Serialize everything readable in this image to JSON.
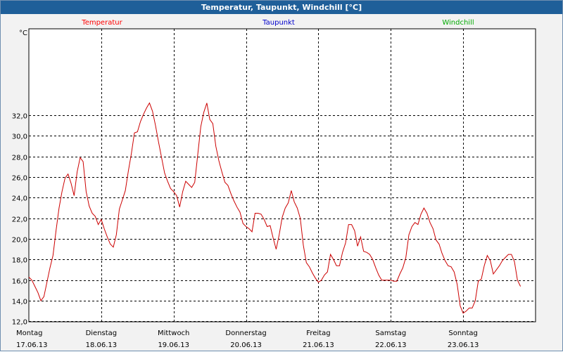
{
  "window": {
    "title": "Temperatur, Taupunkt, Windchill [°C]"
  },
  "chart_data": {
    "type": "line",
    "title": "Temperatur, Taupunkt, Windchill [°C]",
    "ylabel": "°C",
    "ylim": [
      11.96,
      40.4
    ],
    "yticks": [
      "12,0",
      "14,0",
      "16,0",
      "18,0",
      "20,0",
      "22,0",
      "24,0",
      "26,0",
      "28,0",
      "30,0",
      "32,0"
    ],
    "grid": true,
    "legend": [
      {
        "name": "Temperatur",
        "color": "#ff0000",
        "position": "top-left"
      },
      {
        "name": "Taupunkt",
        "color": "#0000cc",
        "position": "top-center"
      },
      {
        "name": "Windchill",
        "color": "#00aa00",
        "position": "top-right"
      }
    ],
    "x_day_labels": [
      {
        "day": "Montag",
        "date": "17.06.13"
      },
      {
        "day": "Dienstag",
        "date": "18.06.13"
      },
      {
        "day": "Mittwoch",
        "date": "19.06.13"
      },
      {
        "day": "Donnerstag",
        "date": "20.06.13"
      },
      {
        "day": "Freitag",
        "date": "21.06.13"
      },
      {
        "day": "Samstag",
        "date": "22.06.13"
      },
      {
        "day": "Sonntag",
        "date": "23.06.13"
      }
    ],
    "x_unit": "hours since 17.06.13 00:00",
    "xlim": [
      0,
      168
    ],
    "series": [
      {
        "name": "Temperatur",
        "color": "#cc0000",
        "points": [
          [
            0,
            16.3
          ],
          [
            1,
            16.0
          ],
          [
            2,
            15.4
          ],
          [
            3,
            14.8
          ],
          [
            4,
            14.0
          ],
          [
            5,
            14.4
          ],
          [
            6,
            15.8
          ],
          [
            7,
            17.2
          ],
          [
            8,
            18.4
          ],
          [
            9,
            20.8
          ],
          [
            10,
            23.0
          ],
          [
            11,
            24.6
          ],
          [
            12,
            25.9
          ],
          [
            13,
            26.3
          ],
          [
            14,
            25.4
          ],
          [
            15,
            24.2
          ],
          [
            16,
            26.5
          ],
          [
            17,
            27.9
          ],
          [
            18,
            27.5
          ],
          [
            19,
            24.6
          ],
          [
            20,
            23.2
          ],
          [
            21,
            22.5
          ],
          [
            22,
            22.2
          ],
          [
            23,
            21.4
          ],
          [
            24,
            21.9
          ],
          [
            25,
            21.0
          ],
          [
            26,
            20.2
          ],
          [
            27,
            19.5
          ],
          [
            28,
            19.2
          ],
          [
            29,
            20.4
          ],
          [
            30,
            22.9
          ],
          [
            31,
            23.8
          ],
          [
            32,
            24.7
          ],
          [
            33,
            26.6
          ],
          [
            34,
            28.3
          ],
          [
            35,
            30.3
          ],
          [
            36,
            30.4
          ],
          [
            37,
            31.4
          ],
          [
            38,
            32.1
          ],
          [
            39,
            32.7
          ],
          [
            40,
            33.2
          ],
          [
            41,
            32.4
          ],
          [
            42,
            31.0
          ],
          [
            43,
            29.4
          ],
          [
            44,
            27.9
          ],
          [
            45,
            26.4
          ],
          [
            46,
            25.6
          ],
          [
            47,
            24.9
          ],
          [
            48,
            24.6
          ],
          [
            49,
            24.2
          ],
          [
            50,
            23.1
          ],
          [
            51,
            24.6
          ],
          [
            52,
            25.6
          ],
          [
            53,
            25.3
          ],
          [
            54,
            25.0
          ],
          [
            55,
            25.5
          ],
          [
            56,
            28.2
          ],
          [
            57,
            30.9
          ],
          [
            58,
            32.3
          ],
          [
            59,
            33.2
          ],
          [
            60,
            31.6
          ],
          [
            61,
            31.2
          ],
          [
            62,
            29.0
          ],
          [
            63,
            27.6
          ],
          [
            64,
            26.5
          ],
          [
            65,
            25.5
          ],
          [
            66,
            25.2
          ],
          [
            67,
            24.4
          ],
          [
            68,
            23.7
          ],
          [
            69,
            23.1
          ],
          [
            70,
            22.6
          ],
          [
            71,
            21.5
          ],
          [
            72,
            21.2
          ],
          [
            73,
            21.0
          ],
          [
            74,
            20.7
          ],
          [
            75,
            22.5
          ],
          [
            76,
            22.5
          ],
          [
            77,
            22.4
          ],
          [
            78,
            21.9
          ],
          [
            79,
            21.2
          ],
          [
            80,
            21.3
          ],
          [
            81,
            20.1
          ],
          [
            82,
            19.0
          ],
          [
            83,
            20.4
          ],
          [
            84,
            22.1
          ],
          [
            85,
            23.0
          ],
          [
            86,
            23.5
          ],
          [
            87,
            24.7
          ],
          [
            88,
            23.6
          ],
          [
            89,
            23.0
          ],
          [
            90,
            22.0
          ],
          [
            91,
            19.4
          ],
          [
            92,
            17.7
          ],
          [
            93,
            17.3
          ],
          [
            94,
            16.7
          ],
          [
            95,
            16.2
          ],
          [
            96,
            15.8
          ],
          [
            97,
            16.0
          ],
          [
            98,
            16.5
          ],
          [
            99,
            16.8
          ],
          [
            100,
            18.5
          ],
          [
            101,
            18.0
          ],
          [
            102,
            17.4
          ],
          [
            103,
            17.4
          ],
          [
            104,
            18.7
          ],
          [
            105,
            19.6
          ],
          [
            106,
            21.4
          ],
          [
            107,
            21.4
          ],
          [
            108,
            20.8
          ],
          [
            109,
            19.3
          ],
          [
            110,
            20.2
          ],
          [
            111,
            18.8
          ],
          [
            112,
            18.7
          ],
          [
            113,
            18.5
          ],
          [
            114,
            18.0
          ],
          [
            115,
            17.2
          ],
          [
            116,
            16.5
          ],
          [
            117,
            16.0
          ],
          [
            118,
            16.0
          ],
          [
            119,
            16.0
          ],
          [
            120,
            16.0
          ],
          [
            121,
            15.9
          ],
          [
            122,
            15.9
          ],
          [
            123,
            16.6
          ],
          [
            124,
            17.2
          ],
          [
            125,
            18.2
          ],
          [
            126,
            20.4
          ],
          [
            127,
            21.2
          ],
          [
            128,
            21.6
          ],
          [
            129,
            21.4
          ],
          [
            130,
            22.4
          ],
          [
            131,
            23.0
          ],
          [
            132,
            22.5
          ],
          [
            133,
            21.6
          ],
          [
            134,
            21.0
          ],
          [
            135,
            19.9
          ],
          [
            136,
            19.5
          ],
          [
            137,
            18.6
          ],
          [
            138,
            17.9
          ],
          [
            139,
            17.4
          ],
          [
            140,
            17.3
          ],
          [
            141,
            16.8
          ],
          [
            142,
            15.6
          ],
          [
            143,
            13.5
          ],
          [
            144,
            12.8
          ],
          [
            145,
            13.0
          ],
          [
            146,
            13.3
          ],
          [
            147,
            13.3
          ],
          [
            148,
            14.0
          ],
          [
            149,
            15.9
          ],
          [
            150,
            16.1
          ],
          [
            151,
            17.4
          ],
          [
            152,
            18.4
          ],
          [
            153,
            17.9
          ],
          [
            154,
            16.6
          ],
          [
            155,
            17.0
          ],
          [
            156,
            17.4
          ],
          [
            157,
            17.9
          ],
          [
            158,
            18.2
          ],
          [
            159,
            18.5
          ],
          [
            160,
            18.5
          ],
          [
            161,
            17.8
          ],
          [
            162,
            16.0
          ],
          [
            163,
            15.4
          ]
        ]
      }
    ]
  }
}
